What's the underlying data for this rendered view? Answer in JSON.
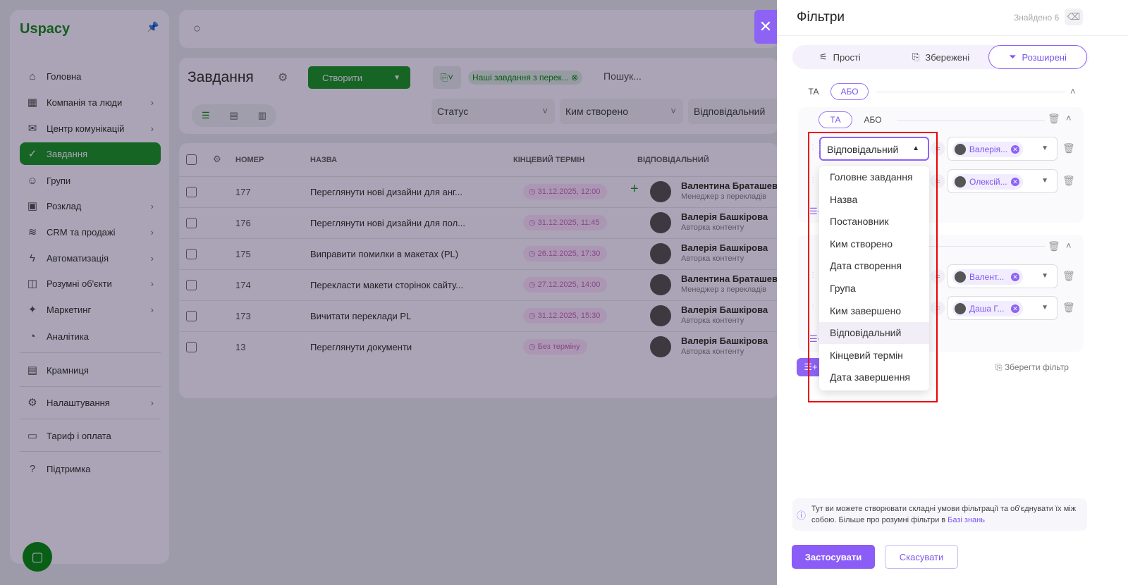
{
  "sidebar": {
    "logo": "Uspacy",
    "items": [
      {
        "label": "Головна",
        "icon": "home-icon",
        "chev": false
      },
      {
        "label": "Компанія та люди",
        "icon": "company-icon",
        "chev": true
      },
      {
        "label": "Центр комунікацій",
        "icon": "communication-icon",
        "chev": true
      },
      {
        "label": "Завдання",
        "icon": "tasks-icon",
        "chev": false,
        "active": true
      },
      {
        "label": "Групи",
        "icon": "groups-icon",
        "chev": false
      },
      {
        "label": "Розклад",
        "icon": "calendar-icon",
        "chev": true
      },
      {
        "label": "CRM та продажі",
        "icon": "crm-icon",
        "chev": true
      },
      {
        "label": "Автоматизація",
        "icon": "automation-icon",
        "chev": true
      },
      {
        "label": "Розумні об'єкти",
        "icon": "smart-objects-icon",
        "chev": true
      },
      {
        "label": "Маркетинг",
        "icon": "marketing-icon",
        "chev": true
      },
      {
        "label": "Аналітика",
        "icon": "analytics-icon",
        "chev": false
      },
      {
        "label": "Крамниця",
        "icon": "store-icon",
        "chev": false
      },
      {
        "label": "Налаштування",
        "icon": "settings-icon",
        "chev": true
      },
      {
        "label": "Тариф і оплата",
        "icon": "wallet-icon",
        "chev": false
      },
      {
        "label": "Підтримка",
        "icon": "support-icon",
        "chev": false
      }
    ]
  },
  "main": {
    "title": "Завдання",
    "create": "Створити",
    "saved_filter_chip": "Наші завдання з перек...",
    "search_placeholder": "Пошук...",
    "filters": [
      "Статус",
      "Ким створено",
      "Відповідальний"
    ],
    "columns": [
      "НОМЕР",
      "НАЗВА",
      "КІНЦЕВИЙ ТЕРМІН",
      "ВІДПОВІДАЛЬНИЙ"
    ],
    "rows": [
      {
        "num": "177",
        "name": "Переглянути нові дизайни для анг...",
        "due": "31.12.2025, 12:00",
        "person": "Валентина Браташевс",
        "role": "Менеджер з перекладів"
      },
      {
        "num": "176",
        "name": "Переглянути нові дизайни для пол...",
        "due": "31.12.2025, 11:45",
        "person": "Валерія Башкірова",
        "role": "Авторка контенту"
      },
      {
        "num": "175",
        "name": "Виправити помилки в макетах (PL)",
        "due": "26.12.2025, 17:30",
        "person": "Валерія Башкірова",
        "role": "Авторка контенту"
      },
      {
        "num": "174",
        "name": "Перекласти макети сторінок сайту...",
        "due": "27.12.2025, 14:00",
        "person": "Валентина Браташевс",
        "role": "Менеджер з перекладів"
      },
      {
        "num": "173",
        "name": "Вичитати переклади PL",
        "due": "31.12.2025, 15:30",
        "person": "Валерія Башкірова",
        "role": "Авторка контенту"
      },
      {
        "num": "13",
        "name": "Переглянути документи",
        "due": "Без терміну",
        "person": "Валерія Башкірова",
        "role": "Авторка контенту"
      }
    ]
  },
  "panel": {
    "title": "Фільтри",
    "found": "Знайдено 6",
    "tabs": [
      "Прості",
      "Збережені",
      "Розширені"
    ],
    "and": "ТА",
    "or": "АБО",
    "field_selected": "Відповідальний",
    "values": [
      "Валерія...",
      "Олексій...",
      "Валент...",
      "Даша Г..."
    ],
    "options": [
      "Головне завдання",
      "Назва",
      "Постановник",
      "Ким створено",
      "Дата створення",
      "Група",
      "Ким завершено",
      "Відповідальний",
      "Кінцевий термін",
      "Дата завершення"
    ],
    "save_filter": "Зберегти фільтр",
    "hint": "Тут ви можете створювати складні умови фільтрації та об'єднувати їх між собою. Більше про розумні фільтри в ",
    "hint_link": "Базі знань",
    "apply": "Застосувати",
    "cancel": "Скасувати"
  },
  "colors": {
    "accent": "#8c63f5",
    "highlight": "#ee0000"
  }
}
